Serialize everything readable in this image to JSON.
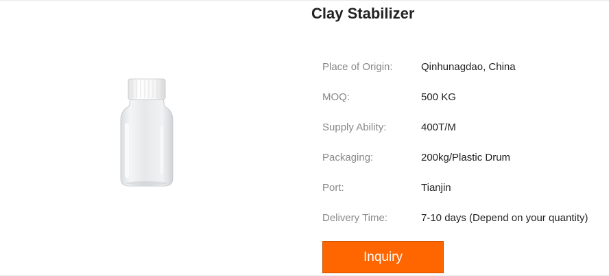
{
  "product": {
    "title": "Clay Stabilizer",
    "image_icon": "clear-plastic-bottle-with-white-cap"
  },
  "specs": [
    {
      "label": "Place of Origin:",
      "value": "Qinhunagdao, China"
    },
    {
      "label": "MOQ:",
      "value": "500 KG"
    },
    {
      "label": "Supply Ability:",
      "value": "400T/M"
    },
    {
      "label": "Packaging:",
      "value": "200kg/Plastic Drum"
    },
    {
      "label": "Port:",
      "value": "Tianjin"
    },
    {
      "label": "Delivery Time:",
      "value": "7-10 days (Depend on your quantity)"
    }
  ],
  "actions": {
    "inquiry_label": "Inquiry"
  },
  "colors": {
    "accent": "#ff6600",
    "label_text": "#888888",
    "value_text": "#222222"
  }
}
